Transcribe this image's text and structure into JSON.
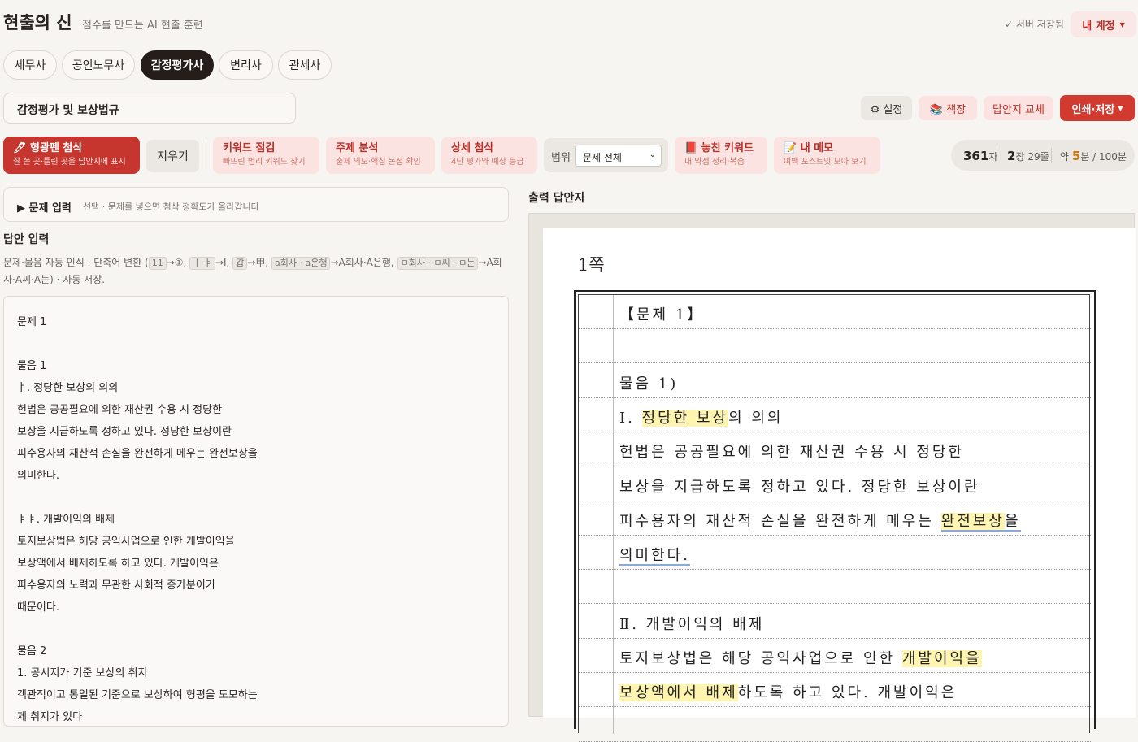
{
  "header": {
    "title": "현출의 신",
    "subtitle": "점수를 만드는 AI 현출 훈련",
    "saved": "✓ 서버 저장됨",
    "account": "내 계정"
  },
  "exams": [
    "세무사",
    "공인노무사",
    "감정평가사",
    "변리사",
    "관세사"
  ],
  "subject": "감정평가 및 보상법규",
  "actions": {
    "settings": "⚙ 설정",
    "shelf": "📚 책장",
    "swap": "답안지 교체",
    "print": "인쇄·저장"
  },
  "tools": {
    "highlight": {
      "title": "🖊 형광펜 첨삭",
      "desc": "잘 쓴 곳·틀린 곳을 답안지에 표시"
    },
    "clear": "지우기",
    "keyword": {
      "title": "키워드 점검",
      "desc": "빠뜨린 법리 키워드 찾기"
    },
    "theme": {
      "title": "주제 분석",
      "desc": "출제 의도·핵심 논점 확인"
    },
    "detail": {
      "title": "상세 첨삭",
      "desc": "4단 평가와 예상 등급"
    },
    "range_label": "범위",
    "range_value": "문제 전체",
    "missed": {
      "title": "📕 놓친 키워드",
      "desc": "내 약점 정리·복습"
    },
    "memo": {
      "title": "📝 내 메모",
      "desc": "여백 포스트잇 모아 보기"
    }
  },
  "stats": {
    "chars": "361",
    "chars_unit": "자",
    "pages": "2",
    "pages_unit": "장",
    "lines": "29줄",
    "time_prefix": "약",
    "time": "5",
    "time_unit": "분 / 100분"
  },
  "problem": {
    "title": "▶ 문제 입력",
    "hint": "선택 · 문제를 넣으면 첨삭 정확도가 올라갑니다"
  },
  "answer": {
    "title": "답안 입력",
    "desc_pre": "문제·물음 자동 인식 · 단축어 변환 (",
    "c1": "11",
    "a1": "→①,",
    "c2": "ㅣ·ㅑ",
    "a2": "→Ⅰ,",
    "c3": "갑",
    "a3": "→甲,",
    "c4": "a회사 · a은행",
    "a4": "→A회사·A은행,",
    "c5": "ㅁ회사 · ㅁ씨 · ㅁ는",
    "a5": "→A회사·A씨·A는) · 자동 저장.",
    "lines": [
      "문제 1",
      "",
      "물음 1",
      "ㅑ. 정당한 보상의 의의",
      "헌법은 공공필요에 의한 재산권 수용 시 정당한",
      "보상을 지급하도록 정하고 있다. 정당한 보상이란",
      "피수용자의 재산적 손실을 완전하게 메우는 완전보상을",
      "의미한다.",
      "",
      "ㅑㅑ. 개발이익의 배제",
      "토지보상법은 해당 공익사업으로 인한 개발이익을",
      "보상액에서 배제하도록 하고 있다. 개발이익은",
      "피수용자의 노력과 무관한 사회적 증가분이기",
      "때문이다.",
      "",
      "물음 2",
      "1. 공시지가 기준 보상의 취지",
      "객관적이고 통일된 기준으로 보상하여 형평을 도모하는",
      "제 취지가 있다"
    ]
  },
  "output": {
    "title": "출력 답안지",
    "page": "1쪽",
    "rows": [
      {
        "parts": [
          {
            "t": "【문제 1】"
          }
        ]
      },
      {
        "parts": []
      },
      {
        "parts": [
          {
            "t": "물음 1)"
          }
        ]
      },
      {
        "parts": [
          {
            "t": "Ⅰ. "
          },
          {
            "t": "정당한 보상",
            "m": true
          },
          {
            "t": "의 의의"
          }
        ]
      },
      {
        "parts": [
          {
            "t": "헌법은 공공필요에 의한 재산권 수용 시 정당한"
          }
        ]
      },
      {
        "parts": [
          {
            "t": "보상을 지급하도록 정하고 있다. 정당한 보상이란"
          }
        ]
      },
      {
        "parts": [
          {
            "t": "피수용자의 재산적 손실을 완전하게 메우는 "
          },
          {
            "t": "완전보상",
            "m": true,
            "u": true
          },
          {
            "t": "을",
            "u": true
          }
        ]
      },
      {
        "parts": [
          {
            "t": "의미한다.",
            "u": true
          }
        ]
      },
      {
        "parts": []
      },
      {
        "parts": [
          {
            "t": "Ⅱ. 개발이익의 배제"
          }
        ]
      },
      {
        "parts": [
          {
            "t": "토지보상법은 해당 공익사업으로 인한 "
          },
          {
            "t": "개발이익을",
            "m": true
          }
        ]
      },
      {
        "parts": [
          {
            "t": "보상액에서 배제",
            "m": true
          },
          {
            "t": "하도록 하고 있다. 개발이익은"
          }
        ]
      },
      {
        "parts": []
      }
    ]
  }
}
